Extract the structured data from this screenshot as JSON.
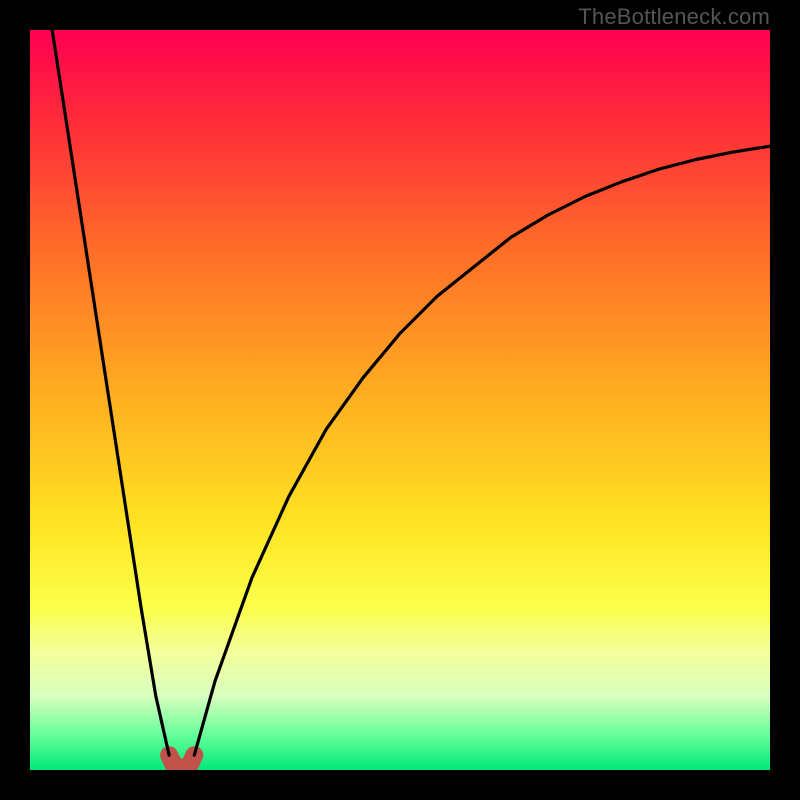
{
  "watermark": "TheBottleneck.com",
  "chart_data": {
    "type": "line",
    "title": "",
    "xlabel": "",
    "ylabel": "",
    "xlim": [
      0,
      100
    ],
    "ylim": [
      0,
      100
    ],
    "grid": false,
    "legend": false,
    "series": [
      {
        "name": "curve-left",
        "x": [
          3,
          5,
          7,
          9,
          11,
          13,
          15,
          17,
          18.8
        ],
        "values": [
          100,
          87,
          74,
          61,
          48,
          35,
          22,
          10,
          2
        ]
      },
      {
        "name": "cusp-marker",
        "x": [
          18.8,
          19.5,
          20.5,
          21.5,
          22.2
        ],
        "values": [
          2,
          0.5,
          0.3,
          0.5,
          2
        ]
      },
      {
        "name": "curve-right",
        "x": [
          22.2,
          25,
          30,
          35,
          40,
          45,
          50,
          55,
          60,
          65,
          70,
          75,
          80,
          85,
          90,
          95,
          100
        ],
        "values": [
          2,
          12,
          26,
          37,
          46,
          53,
          59,
          64,
          68,
          72,
          75,
          77.5,
          79.5,
          81.2,
          82.5,
          83.5,
          84.3
        ]
      }
    ],
    "gradient_stops": [
      {
        "pct": 0,
        "color": "#FF0052"
      },
      {
        "pct": 12,
        "color": "#FF2A3A"
      },
      {
        "pct": 30,
        "color": "#FF6E28"
      },
      {
        "pct": 50,
        "color": "#FFB020"
      },
      {
        "pct": 67,
        "color": "#FFE423"
      },
      {
        "pct": 78,
        "color": "#FBFF4A"
      },
      {
        "pct": 84,
        "color": "#F4FF9A"
      },
      {
        "pct": 90,
        "color": "#D8FFC0"
      },
      {
        "pct": 95,
        "color": "#6CFF9C"
      },
      {
        "pct": 100,
        "color": "#00E97A"
      }
    ],
    "cusp_marker_color": "#C0524A",
    "curve_color": "#000000"
  }
}
